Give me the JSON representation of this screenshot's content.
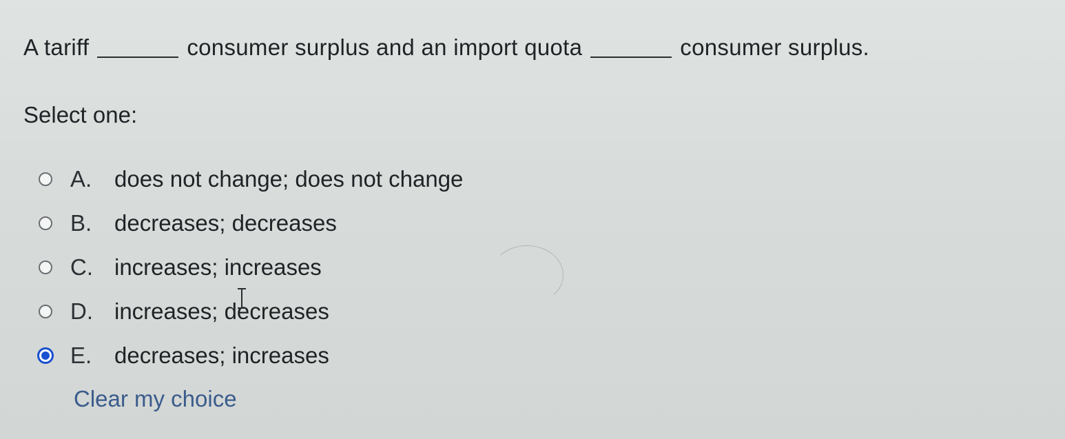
{
  "question": {
    "part1": "A tariff",
    "part2": "consumer surplus and an import quota",
    "part3": "consumer surplus."
  },
  "prompt": "Select one:",
  "options": [
    {
      "letter": "A.",
      "text": "does not change; does not change",
      "selected": false
    },
    {
      "letter": "B.",
      "text": "decreases; decreases",
      "selected": false
    },
    {
      "letter": "C.",
      "text": "increases; increases",
      "selected": false
    },
    {
      "letter": "D.",
      "text": "increases; decreases",
      "selected": false
    },
    {
      "letter": "E.",
      "text": "decreases; increases",
      "selected": true
    }
  ],
  "clear_label": "Clear my choice",
  "colors": {
    "accent": "#1a4fcf",
    "link": "#3a5c8c",
    "text": "#1f2326",
    "background": "#d8dcda"
  }
}
